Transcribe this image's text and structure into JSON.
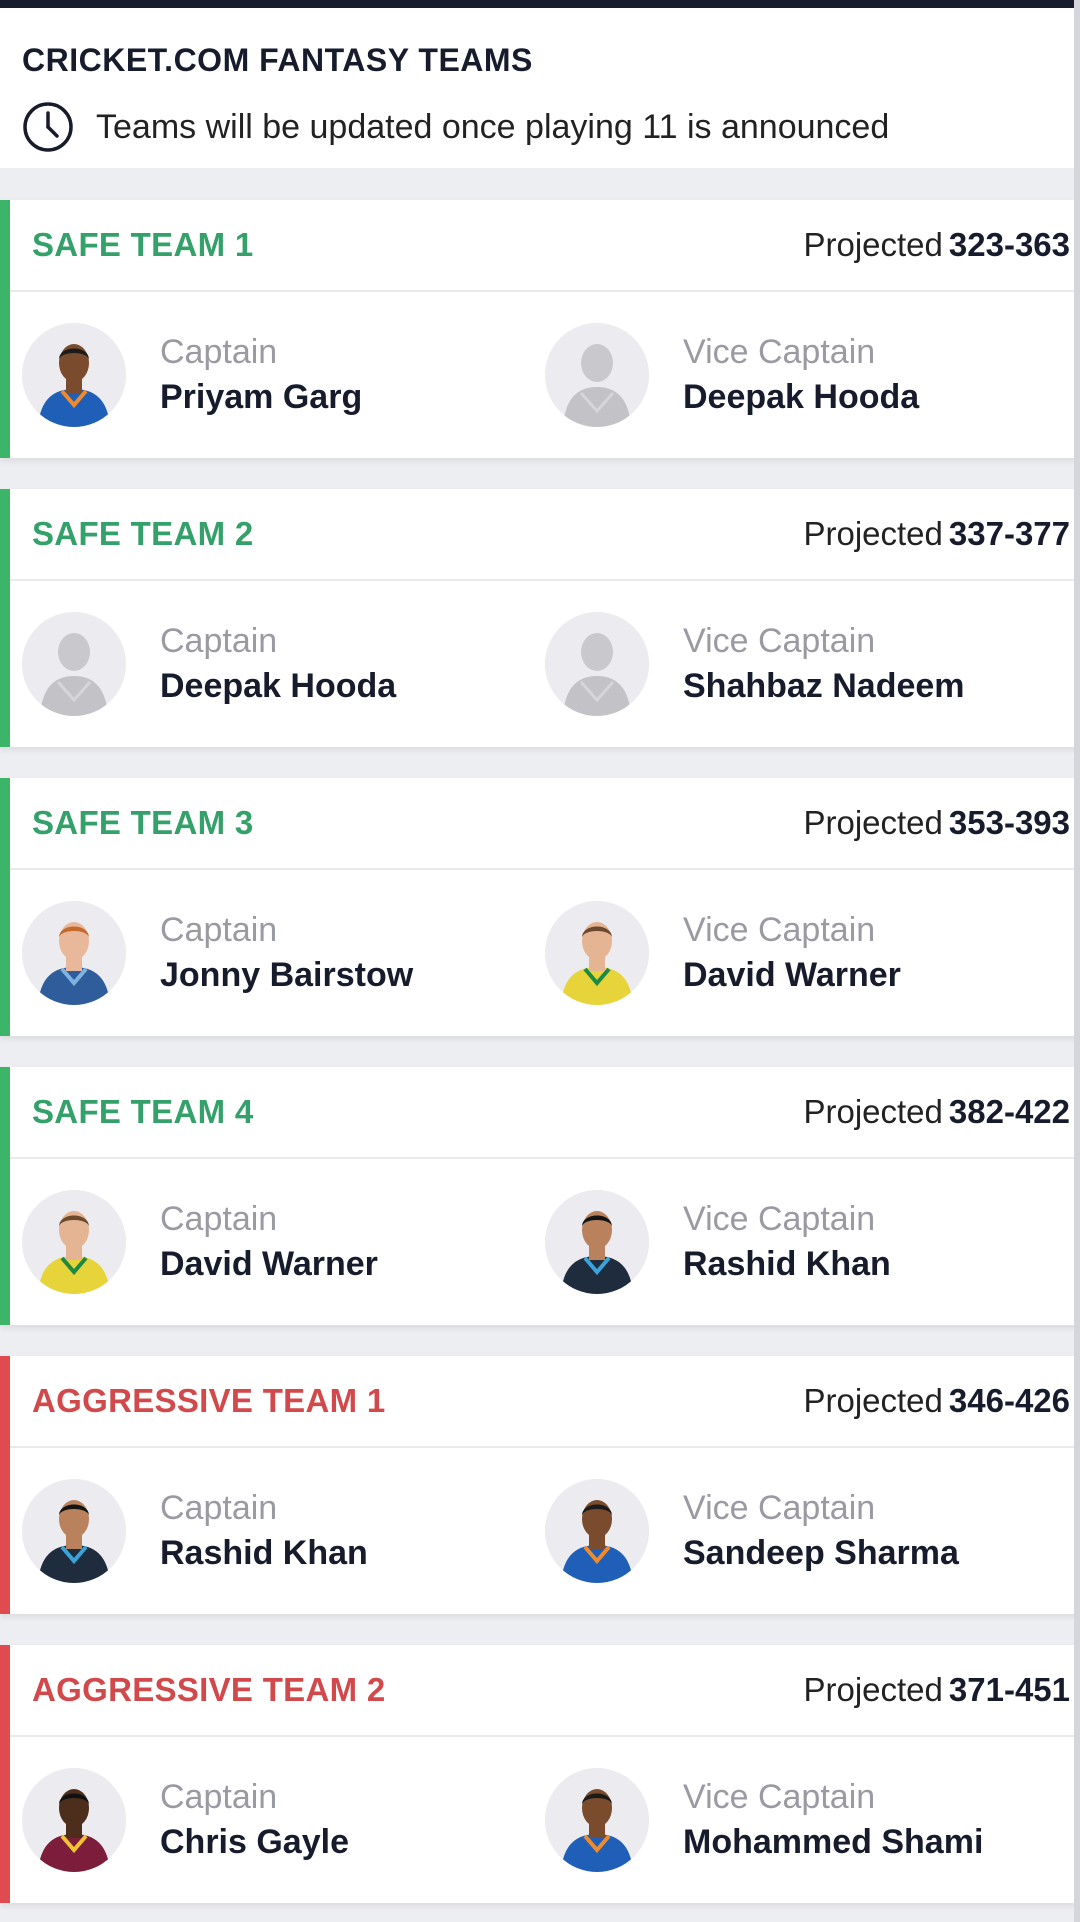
{
  "header": {
    "title": "CRICKET.COM FANTASY TEAMS",
    "note": "Teams will be updated once playing 11 is announced"
  },
  "labels": {
    "projected": "Projected",
    "captain": "Captain",
    "vice_captain": "Vice Captain"
  },
  "colors": {
    "safe": "#34a06a",
    "aggressive": "#d2494c",
    "safe_accent": "#3cb568",
    "aggressive_accent": "#e04b4f"
  },
  "teams": [
    {
      "title": "SAFE TEAM 1",
      "type": "safe",
      "projected": "323-363",
      "captain": "Priyam Garg",
      "vice_captain": "Deepak Hooda",
      "captain_avatar": "player-photo-blue-kit",
      "vice_avatar": "placeholder-silhouette"
    },
    {
      "title": "SAFE TEAM 2",
      "type": "safe",
      "projected": "337-377",
      "captain": "Deepak Hooda",
      "vice_captain": "Shahbaz Nadeem",
      "captain_avatar": "placeholder-silhouette",
      "vice_avatar": "placeholder-silhouette"
    },
    {
      "title": "SAFE TEAM 3",
      "type": "safe",
      "projected": "353-393",
      "captain": "Jonny Bairstow",
      "vice_captain": "David Warner",
      "captain_avatar": "player-photo-navy-kit",
      "vice_avatar": "player-photo-yellow-kit"
    },
    {
      "title": "SAFE TEAM 4",
      "type": "safe",
      "projected": "382-422",
      "captain": "David Warner",
      "vice_captain": "Rashid Khan",
      "captain_avatar": "player-photo-yellow-kit",
      "vice_avatar": "player-photo-dark-kit"
    },
    {
      "title": "AGGRESSIVE TEAM 1",
      "type": "aggressive",
      "projected": "346-426",
      "captain": "Rashid Khan",
      "vice_captain": "Sandeep Sharma",
      "captain_avatar": "player-photo-dark-kit",
      "vice_avatar": "player-photo-blue-kit"
    },
    {
      "title": "AGGRESSIVE TEAM 2",
      "type": "aggressive",
      "projected": "371-451",
      "captain": "Chris Gayle",
      "vice_captain": "Mohammed Shami",
      "captain_avatar": "player-photo-maroon-kit",
      "vice_avatar": "player-photo-blue-kit"
    }
  ]
}
